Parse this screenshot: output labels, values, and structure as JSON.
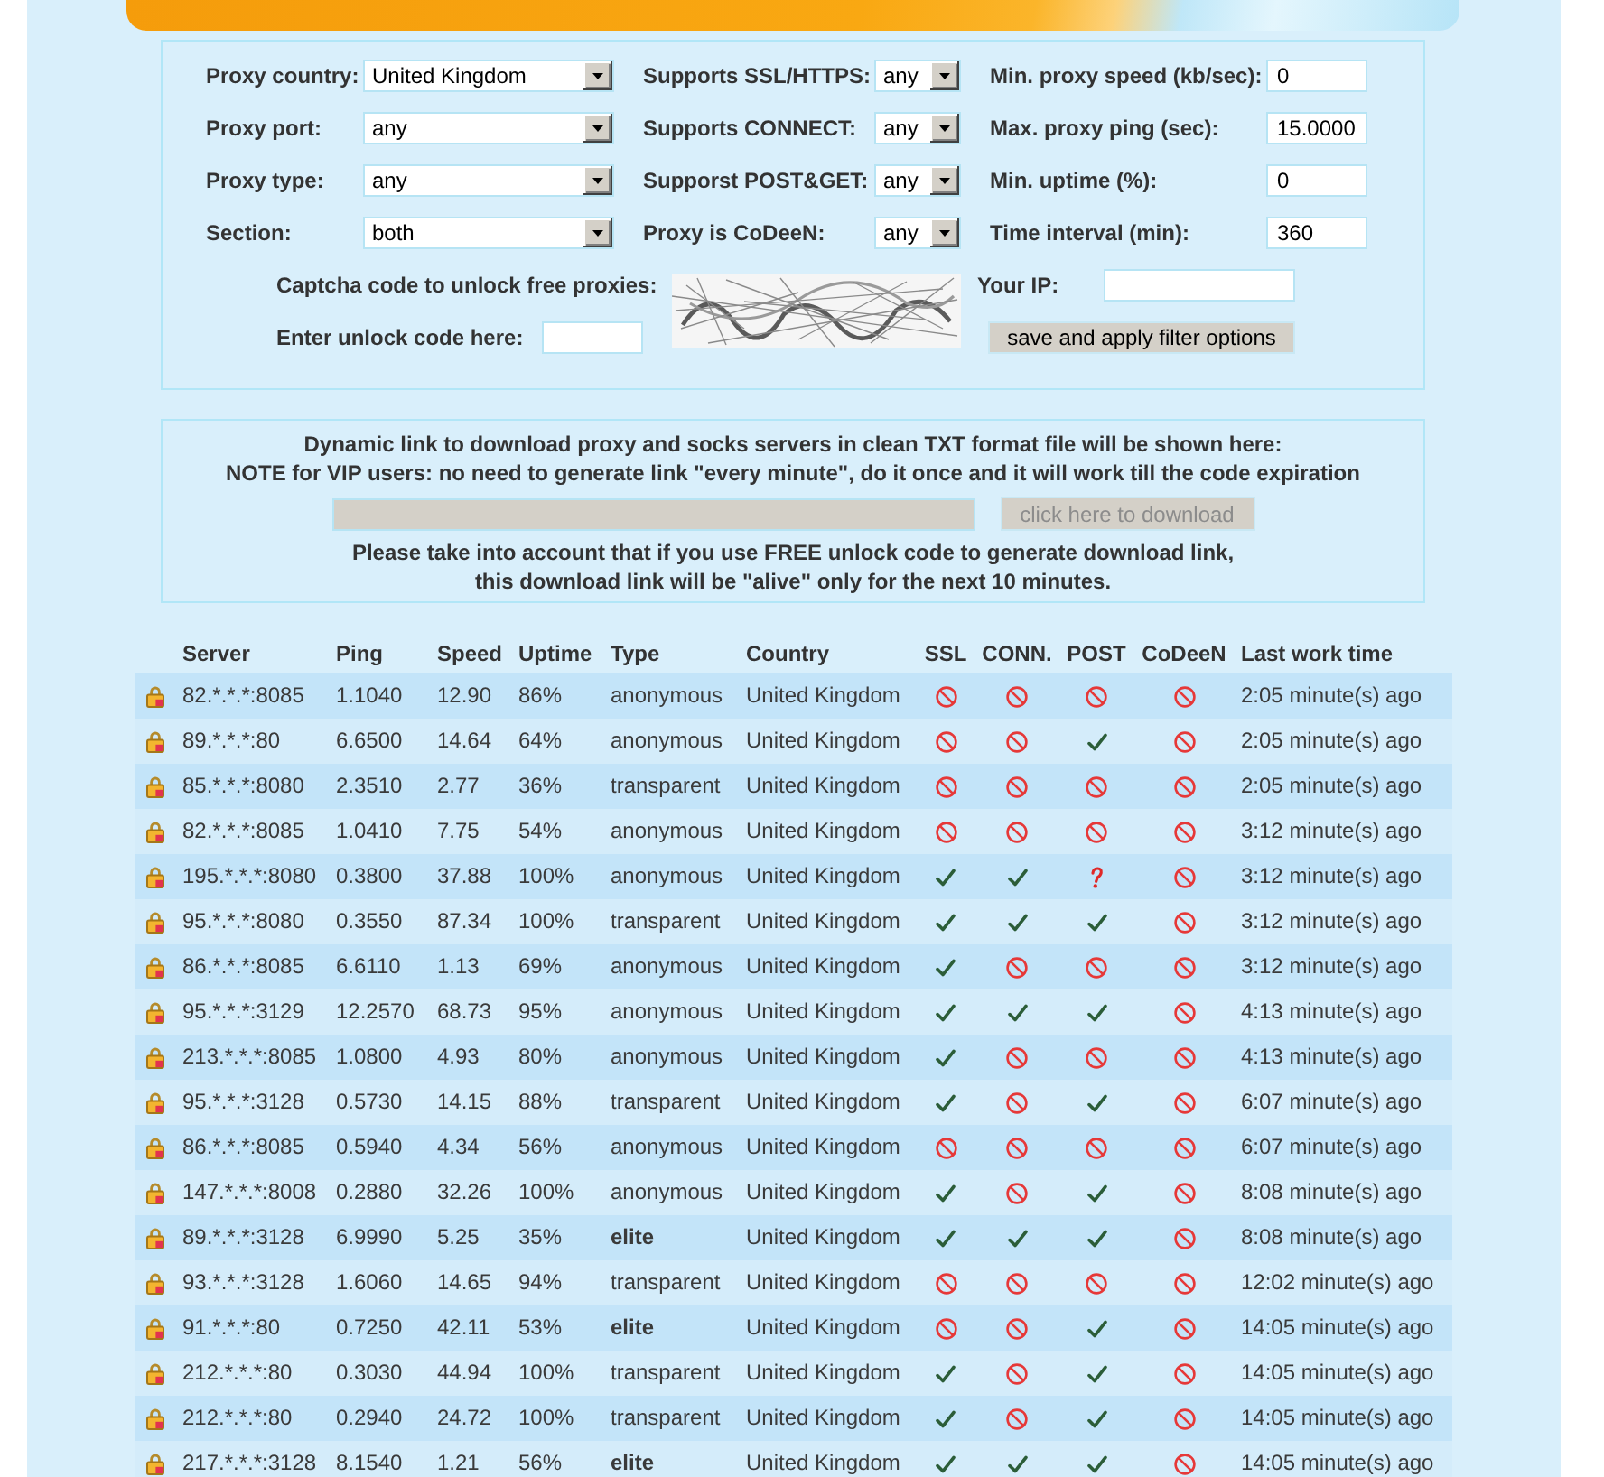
{
  "filter_form": {
    "fields": [
      {
        "label": "Proxy country:",
        "kind": "select",
        "value": "United Kingdom"
      },
      {
        "label": "Supports SSL/HTTPS:",
        "kind": "select",
        "value": "any"
      },
      {
        "label": "Min. proxy speed (kb/sec):",
        "kind": "input",
        "value": "0"
      },
      {
        "label": "Proxy port:",
        "kind": "select",
        "value": "any"
      },
      {
        "label": "Supports CONNECT:",
        "kind": "select",
        "value": "any"
      },
      {
        "label": "Max. proxy ping (sec):",
        "kind": "input",
        "value": "15.0000"
      },
      {
        "label": "Proxy type:",
        "kind": "select",
        "value": "any"
      },
      {
        "label": "Supporst POST&GET:",
        "kind": "select",
        "value": "any"
      },
      {
        "label": "Min. uptime (%):",
        "kind": "input",
        "value": "0"
      },
      {
        "label": "Section:",
        "kind": "select",
        "value": "both"
      },
      {
        "label": "Proxy is CoDeeN:",
        "kind": "select",
        "value": "any"
      },
      {
        "label": "Time interval (min):",
        "kind": "input",
        "value": "360"
      }
    ],
    "captcha": {
      "label": "Captcha code to unlock free proxies:"
    },
    "your_ip": {
      "label": "Your IP:"
    },
    "unlock_code": {
      "label": "Enter unlock code here:"
    },
    "submit_button": {
      "label": "save and apply filter options"
    }
  },
  "download_panel": {
    "notice": "Dynamic link to download proxy and socks servers in clean TXT format file will be shown here:",
    "vip_note": "NOTE for VIP users: no need to generate link \"every minute\", do it once and it will work till the code expiration",
    "link_field": {
      "disabled": true
    },
    "download_button": {
      "label": "click here to download",
      "disabled": true
    },
    "warning_lines": [
      "Please take into account that if you use FREE unlock code to generate download link,",
      "this download link will be \"alive\" only for the next 10 minutes."
    ]
  },
  "table": {
    "columns": [
      "Server",
      "Ping",
      "Speed",
      "Uptime",
      "Type",
      "Country",
      "SSL",
      "CONN.",
      "POST",
      "CoDeeN",
      "Last work time"
    ],
    "rows": [
      {
        "locked": true,
        "server": "82.*.*.*:8085",
        "ping": "1.1040",
        "speed": "12.90",
        "uptime": "86%",
        "type": "anonymous",
        "highlighted": false,
        "country": "United Kingdom",
        "ssl": false,
        "conn": false,
        "post": false,
        "codeen": false,
        "last_work_time": "2:05 minute(s) ago"
      },
      {
        "locked": true,
        "server": "89.*.*.*:80",
        "ping": "6.6500",
        "speed": "14.64",
        "uptime": "64%",
        "type": "anonymous",
        "highlighted": false,
        "country": "United Kingdom",
        "ssl": false,
        "conn": false,
        "post": true,
        "codeen": false,
        "last_work_time": "2:05 minute(s) ago"
      },
      {
        "locked": true,
        "server": "85.*.*.*:8080",
        "ping": "2.3510",
        "speed": "2.77",
        "uptime": "36%",
        "type": "transparent",
        "highlighted": false,
        "country": "United Kingdom",
        "ssl": false,
        "conn": false,
        "post": false,
        "codeen": false,
        "last_work_time": "2:05 minute(s) ago"
      },
      {
        "locked": true,
        "server": "82.*.*.*:8085",
        "ping": "1.0410",
        "speed": "7.75",
        "uptime": "54%",
        "type": "anonymous",
        "highlighted": false,
        "country": "United Kingdom",
        "ssl": false,
        "conn": false,
        "post": false,
        "codeen": false,
        "last_work_time": "3:12 minute(s) ago"
      },
      {
        "locked": true,
        "server": "195.*.*.*:8080",
        "ping": "0.3800",
        "speed": "37.88",
        "uptime": "100%",
        "type": "anonymous",
        "highlighted": false,
        "country": "United Kingdom",
        "ssl": true,
        "conn": true,
        "post": null,
        "codeen": false,
        "last_work_time": "3:12 minute(s) ago"
      },
      {
        "locked": true,
        "server": "95.*.*.*:8080",
        "ping": "0.3550",
        "speed": "87.34",
        "uptime": "100%",
        "type": "transparent",
        "highlighted": false,
        "country": "United Kingdom",
        "ssl": true,
        "conn": true,
        "post": true,
        "codeen": false,
        "last_work_time": "3:12 minute(s) ago"
      },
      {
        "locked": true,
        "server": "86.*.*.*:8085",
        "ping": "6.6110",
        "speed": "1.13",
        "uptime": "69%",
        "type": "anonymous",
        "highlighted": false,
        "country": "United Kingdom",
        "ssl": true,
        "conn": false,
        "post": false,
        "codeen": false,
        "last_work_time": "3:12 minute(s) ago"
      },
      {
        "locked": true,
        "server": "95.*.*.*:3129",
        "ping": "12.2570",
        "speed": "68.73",
        "uptime": "95%",
        "type": "anonymous",
        "highlighted": false,
        "country": "United Kingdom",
        "ssl": true,
        "conn": true,
        "post": true,
        "codeen": false,
        "last_work_time": "4:13 minute(s) ago"
      },
      {
        "locked": true,
        "server": "213.*.*.*:8085",
        "ping": "1.0800",
        "speed": "4.93",
        "uptime": "80%",
        "type": "anonymous",
        "highlighted": false,
        "country": "United Kingdom",
        "ssl": true,
        "conn": false,
        "post": false,
        "codeen": false,
        "last_work_time": "4:13 minute(s) ago"
      },
      {
        "locked": true,
        "server": "95.*.*.*:3128",
        "ping": "0.5730",
        "speed": "14.15",
        "uptime": "88%",
        "type": "transparent",
        "highlighted": false,
        "country": "United Kingdom",
        "ssl": true,
        "conn": false,
        "post": true,
        "codeen": false,
        "last_work_time": "6:07 minute(s) ago"
      },
      {
        "locked": true,
        "server": "86.*.*.*:8085",
        "ping": "0.5940",
        "speed": "4.34",
        "uptime": "56%",
        "type": "anonymous",
        "highlighted": false,
        "country": "United Kingdom",
        "ssl": false,
        "conn": false,
        "post": false,
        "codeen": false,
        "last_work_time": "6:07 minute(s) ago"
      },
      {
        "locked": true,
        "server": "147.*.*.*:8008",
        "ping": "0.2880",
        "speed": "32.26",
        "uptime": "100%",
        "type": "anonymous",
        "highlighted": false,
        "country": "United Kingdom",
        "ssl": true,
        "conn": false,
        "post": true,
        "codeen": false,
        "last_work_time": "8:08 minute(s) ago"
      },
      {
        "locked": true,
        "server": "89.*.*.*:3128",
        "ping": "6.9990",
        "speed": "5.25",
        "uptime": "35%",
        "type": "elite",
        "highlighted": true,
        "country": "United Kingdom",
        "ssl": true,
        "conn": true,
        "post": true,
        "codeen": false,
        "last_work_time": "8:08 minute(s) ago"
      },
      {
        "locked": true,
        "server": "93.*.*.*:3128",
        "ping": "1.6060",
        "speed": "14.65",
        "uptime": "94%",
        "type": "transparent",
        "highlighted": false,
        "country": "United Kingdom",
        "ssl": false,
        "conn": false,
        "post": false,
        "codeen": false,
        "last_work_time": "12:02 minute(s) ago"
      },
      {
        "locked": true,
        "server": "91.*.*.*:80",
        "ping": "0.7250",
        "speed": "42.11",
        "uptime": "53%",
        "type": "elite",
        "highlighted": true,
        "country": "United Kingdom",
        "ssl": false,
        "conn": false,
        "post": true,
        "codeen": false,
        "last_work_time": "14:05 minute(s) ago"
      },
      {
        "locked": true,
        "server": "212.*.*.*:80",
        "ping": "0.3030",
        "speed": "44.94",
        "uptime": "100%",
        "type": "transparent",
        "highlighted": false,
        "country": "United Kingdom",
        "ssl": true,
        "conn": false,
        "post": true,
        "codeen": false,
        "last_work_time": "14:05 minute(s) ago"
      },
      {
        "locked": true,
        "server": "212.*.*.*:80",
        "ping": "0.2940",
        "speed": "24.72",
        "uptime": "100%",
        "type": "transparent",
        "highlighted": false,
        "country": "United Kingdom",
        "ssl": true,
        "conn": false,
        "post": true,
        "codeen": false,
        "last_work_time": "14:05 minute(s) ago"
      },
      {
        "locked": true,
        "server": "217.*.*.*:3128",
        "ping": "8.1540",
        "speed": "1.21",
        "uptime": "56%",
        "type": "elite",
        "highlighted": true,
        "country": "United Kingdom",
        "ssl": true,
        "conn": true,
        "post": true,
        "codeen": false,
        "last_work_time": "14:05 minute(s) ago"
      }
    ]
  }
}
